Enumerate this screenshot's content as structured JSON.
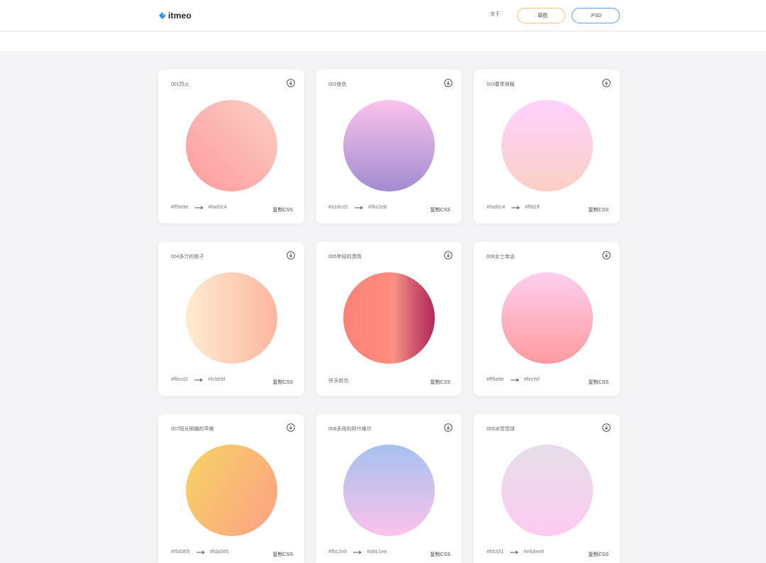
{
  "header": {
    "logo_text": "itmeo",
    "nav_about": "关于",
    "sketch_button": ". 草图",
    "psd_button": ".PSD"
  },
  "copy_label": "复制CSS",
  "cards": [
    {
      "title": "001烈火",
      "from": "#ff9a9e",
      "to": "#fad0c4",
      "code_from": "#ff9a9e",
      "code_to": "#fad0c4",
      "angle": "45deg"
    },
    {
      "title": "002夜色",
      "from": "#a18cd1",
      "to": "#fbc2eb",
      "code_from": "#a18cd1",
      "code_to": "#fbc2eb",
      "angle": "0deg"
    },
    {
      "title": "003春季保暖",
      "from": "#fad0c4",
      "to": "#ffd1ff",
      "code_from": "#fad0c4",
      "code_to": "#ffd1ff",
      "angle": "0deg"
    },
    {
      "title": "004多汁的桃子",
      "from": "#ffecd2",
      "to": "#fcb69f",
      "code_from": "#ffecd2",
      "code_to": "#fcb69f",
      "angle": "90deg"
    },
    {
      "title": "005年轻的激情",
      "multi_label": "很多颜色",
      "colors": [
        "#ff8177",
        "#ff867a",
        "#ff8c7f",
        "#f99185",
        "#cf556c",
        "#b12a5b"
      ]
    },
    {
      "title": "006女士幸运",
      "from": "#ff9a9e",
      "to": "#fecfef",
      "code_from": "#ff9a9e",
      "code_to": "#fecfef",
      "angle": "0deg"
    },
    {
      "title": "007阳光明媚的早晨",
      "from": "#f6d365",
      "to": "#fda085",
      "code_from": "#f6d365",
      "code_to": "#fda085",
      "angle": "120deg"
    },
    {
      "title": "008多雨的阿什维尔",
      "from": "#fbc2eb",
      "to": "#a6c1ee",
      "code_from": "#fbc2eb",
      "code_to": "#a6c1ee",
      "angle": "0deg"
    },
    {
      "title": "009冰雪雪球",
      "from": "#fdcbf1",
      "to": "#e6dee9",
      "code_from": "#fdcbf1",
      "code_to": "#e6dee9",
      "angle": "0deg"
    }
  ]
}
